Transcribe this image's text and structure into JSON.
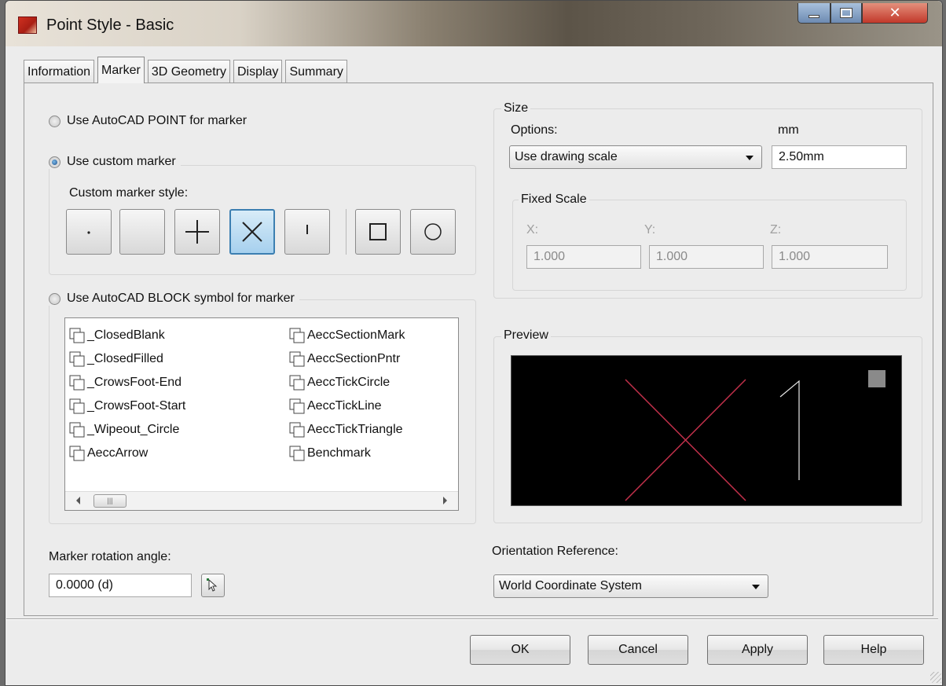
{
  "window": {
    "title": "Point Style - Basic"
  },
  "tabs": [
    {
      "label": "Information"
    },
    {
      "label": "Marker"
    },
    {
      "label": "3D Geometry"
    },
    {
      "label": "Display"
    },
    {
      "label": "Summary"
    }
  ],
  "marker": {
    "option_point": "Use AutoCAD POINT for marker",
    "option_custom": "Use custom marker",
    "custom_style_label": "Custom marker style:",
    "option_block": "Use AutoCAD BLOCK symbol for marker",
    "custom_buttons": [
      {
        "icon": "dot-marker-icon",
        "glyph": "·"
      },
      {
        "icon": "none-marker-icon",
        "glyph": ""
      },
      {
        "icon": "plus-marker-icon",
        "glyph": "+"
      },
      {
        "icon": "x-marker-icon",
        "glyph": "×"
      },
      {
        "icon": "tick-marker-icon",
        "glyph": "!"
      },
      {
        "icon": "square-marker-icon",
        "glyph": "□"
      },
      {
        "icon": "circle-marker-icon",
        "glyph": "○"
      }
    ],
    "block_list_col1": [
      "_ClosedBlank",
      "_ClosedFilled",
      "_CrowsFoot-End",
      "_CrowsFoot-Start",
      "_Wipeout_Circle",
      "AeccArrow"
    ],
    "block_list_col2": [
      "AeccSectionMark",
      "AeccSectionPntr",
      "AeccTickCircle",
      "AeccTickLine",
      "AeccTickTriangle",
      "Benchmark"
    ],
    "rotation_label": "Marker rotation angle:",
    "rotation_value": "0.0000 (d)"
  },
  "size": {
    "legend": "Size",
    "options_label": "Options:",
    "units_label": "mm",
    "options_value": "Use drawing scale",
    "size_value": "2.50mm",
    "fixed_scale_legend": "Fixed Scale",
    "x_label": "X:",
    "y_label": "Y:",
    "z_label": "Z:",
    "x_value": "1.000",
    "y_value": "1.000",
    "z_value": "1.000"
  },
  "preview": {
    "legend": "Preview"
  },
  "orientation": {
    "label": "Orientation Reference:",
    "value": "World Coordinate System"
  },
  "buttons": {
    "ok": "OK",
    "cancel": "Cancel",
    "apply": "Apply",
    "help": "Help"
  },
  "colors": {
    "preview_x": "#c0304a",
    "preview_label": "#e8e8e8",
    "radio_selected": "#1d4f8a"
  }
}
